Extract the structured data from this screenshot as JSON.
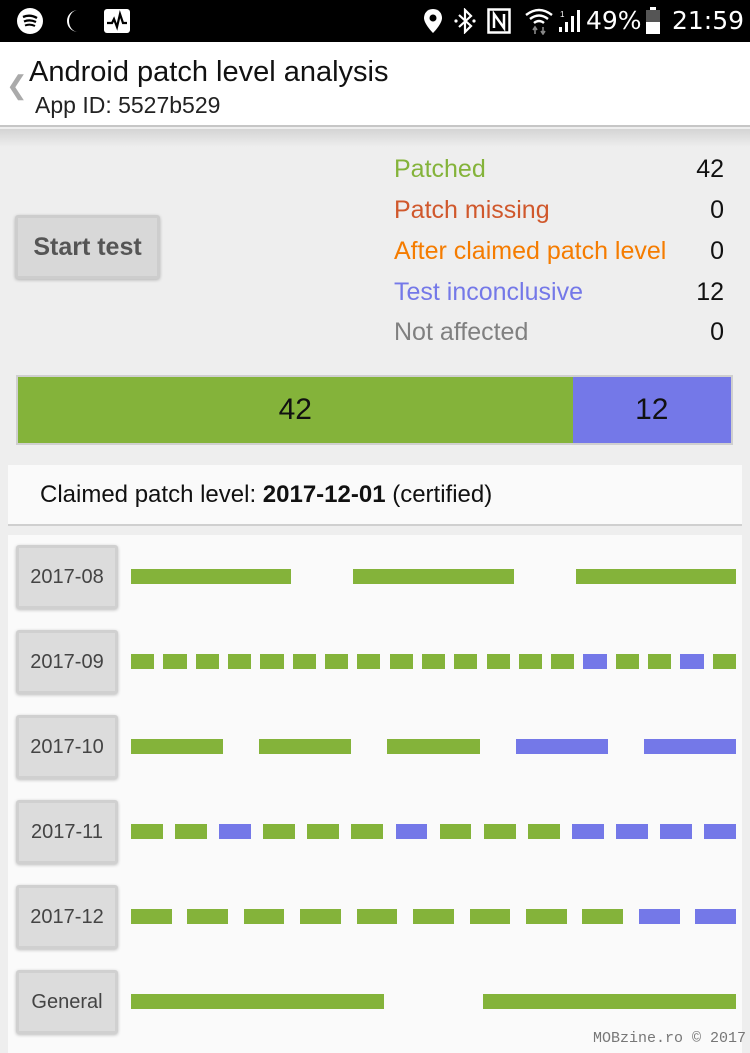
{
  "status_bar": {
    "left_icons": [
      "spotify-icon",
      "moon-icon",
      "activity-monitor-icon"
    ],
    "right_icons": [
      "location-icon",
      "bluetooth-icon",
      "nfc-icon",
      "wifi-icon",
      "signal-icon"
    ],
    "battery": "49%",
    "time": "21:59"
  },
  "app_bar": {
    "back_glyph": "❮",
    "title": "Android patch level analysis",
    "subtitle": "App ID: 5527b529"
  },
  "start_button_label": "Start test",
  "colors": {
    "patched": "#84b33a",
    "missing": "#d0582c",
    "after_claimed": "#f57c00",
    "inconclusive": "#7478e8",
    "not_affected": "#808080"
  },
  "legend": [
    {
      "label": "Patched",
      "value": "42",
      "status": "patched"
    },
    {
      "label": "Patch missing",
      "value": "0",
      "status": "missing"
    },
    {
      "label": "After claimed patch level",
      "value": "0",
      "status": "after_claimed"
    },
    {
      "label": "Test inconclusive",
      "value": "12",
      "status": "inconclusive"
    },
    {
      "label": "Not affected",
      "value": "0",
      "status": "not_affected"
    }
  ],
  "summary_bar": [
    {
      "label": "42",
      "count": 42,
      "status": "patched"
    },
    {
      "label": "12",
      "count": 12,
      "status": "inconclusive"
    }
  ],
  "claimed": {
    "prefix": "Claimed patch level: ",
    "date": "2017-12-01",
    "suffix": " (certified)"
  },
  "rows": [
    {
      "label": "2017-08",
      "tests": [
        "patched",
        "patched",
        "patched"
      ]
    },
    {
      "label": "2017-09",
      "tests": [
        "patched",
        "patched",
        "patched",
        "patched",
        "patched",
        "patched",
        "patched",
        "patched",
        "patched",
        "patched",
        "patched",
        "patched",
        "patched",
        "patched",
        "inconclusive",
        "patched",
        "patched",
        "inconclusive",
        "patched"
      ]
    },
    {
      "label": "2017-10",
      "tests": [
        "patched",
        "patched",
        "patched",
        "inconclusive",
        "inconclusive"
      ]
    },
    {
      "label": "2017-11",
      "tests": [
        "patched",
        "patched",
        "inconclusive",
        "patched",
        "patched",
        "patched",
        "inconclusive",
        "patched",
        "patched",
        "patched",
        "inconclusive",
        "inconclusive",
        "inconclusive",
        "inconclusive"
      ]
    },
    {
      "label": "2017-12",
      "tests": [
        "patched",
        "patched",
        "patched",
        "patched",
        "patched",
        "patched",
        "patched",
        "patched",
        "patched",
        "inconclusive",
        "inconclusive"
      ]
    },
    {
      "label": "General",
      "tests": [
        "patched",
        "patched"
      ]
    }
  ],
  "watermark": "MOBzine.ro © 2017"
}
